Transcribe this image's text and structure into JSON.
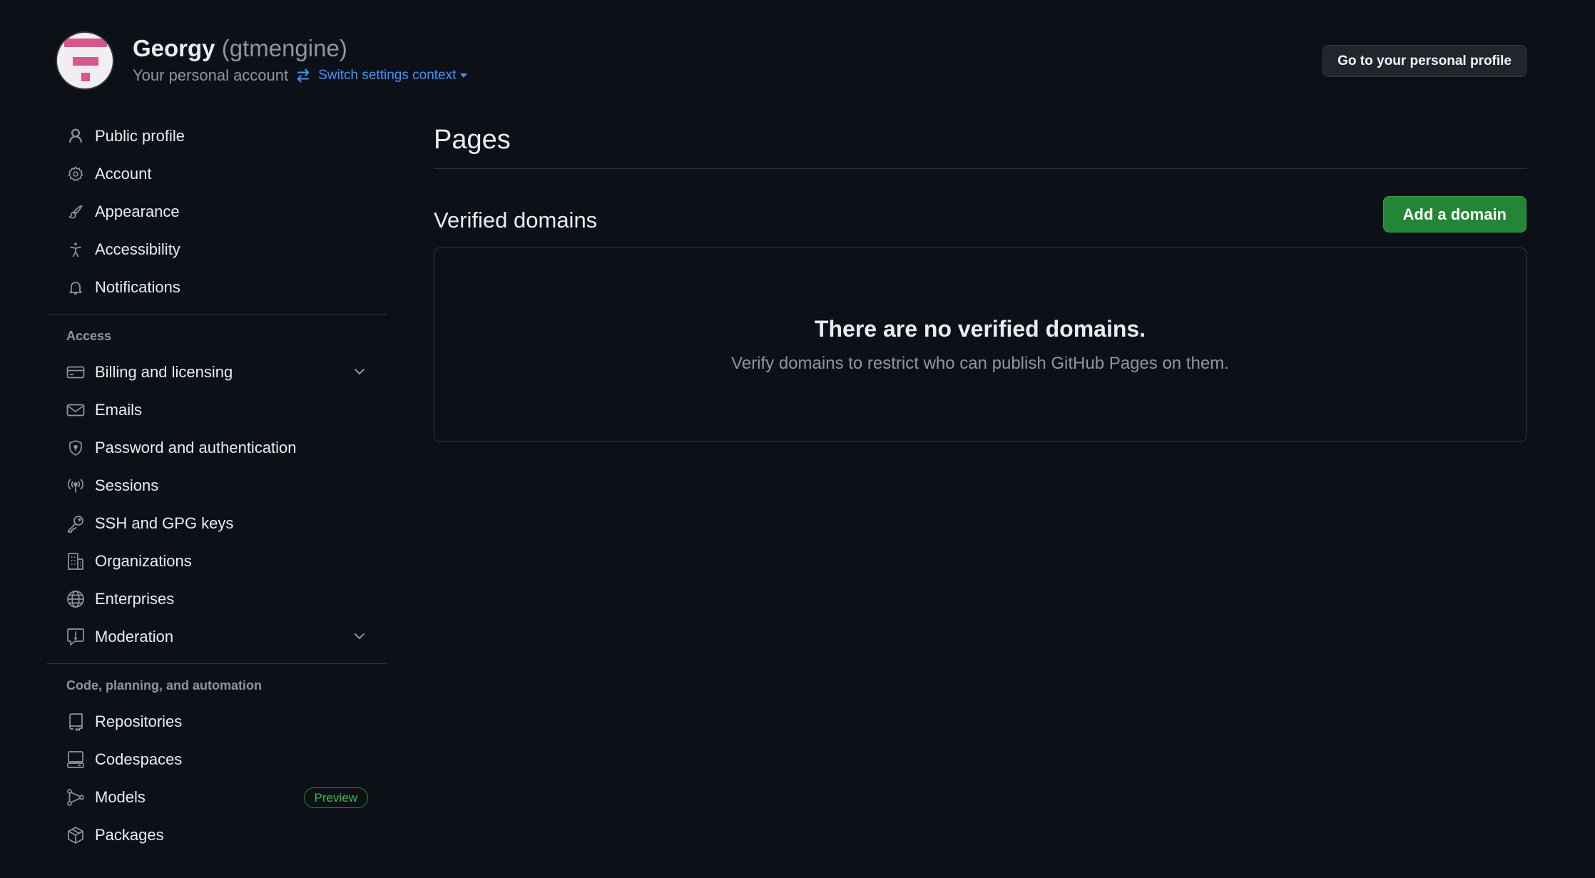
{
  "header": {
    "display_name": "Georgy",
    "login": "(gtmengine)",
    "account_type": "Your personal account",
    "switch_context": "Switch settings context",
    "profile_button": "Go to your personal profile"
  },
  "sidebar": {
    "top_items": [
      {
        "label": "Public profile",
        "icon": "person-icon"
      },
      {
        "label": "Account",
        "icon": "gear-icon"
      },
      {
        "label": "Appearance",
        "icon": "paintbrush-icon"
      },
      {
        "label": "Accessibility",
        "icon": "accessibility-icon"
      },
      {
        "label": "Notifications",
        "icon": "bell-icon"
      }
    ],
    "access_title": "Access",
    "access_items": [
      {
        "label": "Billing and licensing",
        "icon": "credit-card-icon"
      },
      {
        "label": "Emails",
        "icon": "mail-icon"
      },
      {
        "label": "Password and authentication",
        "icon": "shield-lock-icon"
      },
      {
        "label": "Sessions",
        "icon": "broadcast-icon"
      },
      {
        "label": "SSH and GPG keys",
        "icon": "key-icon"
      },
      {
        "label": "Organizations",
        "icon": "organization-icon"
      },
      {
        "label": "Enterprises",
        "icon": "globe-icon"
      },
      {
        "label": "Moderation",
        "icon": "report-icon"
      }
    ],
    "code_title": "Code, planning, and automation",
    "code_items": [
      {
        "label": "Repositories",
        "icon": "repo-icon"
      },
      {
        "label": "Codespaces",
        "icon": "codespaces-icon"
      },
      {
        "label": "Models",
        "icon": "models-icon",
        "badge": "Preview"
      },
      {
        "label": "Packages",
        "icon": "package-icon"
      }
    ]
  },
  "main": {
    "title": "Pages",
    "section_title": "Verified domains",
    "add_button": "Add a domain",
    "empty_title": "There are no verified domains.",
    "empty_description": "Verify domains to restrict who can publish GitHub Pages on them."
  },
  "colors": {
    "background": "#0d1117",
    "accent_link": "#4493f8",
    "primary_button": "#238636",
    "muted_text": "#8d96a0"
  }
}
